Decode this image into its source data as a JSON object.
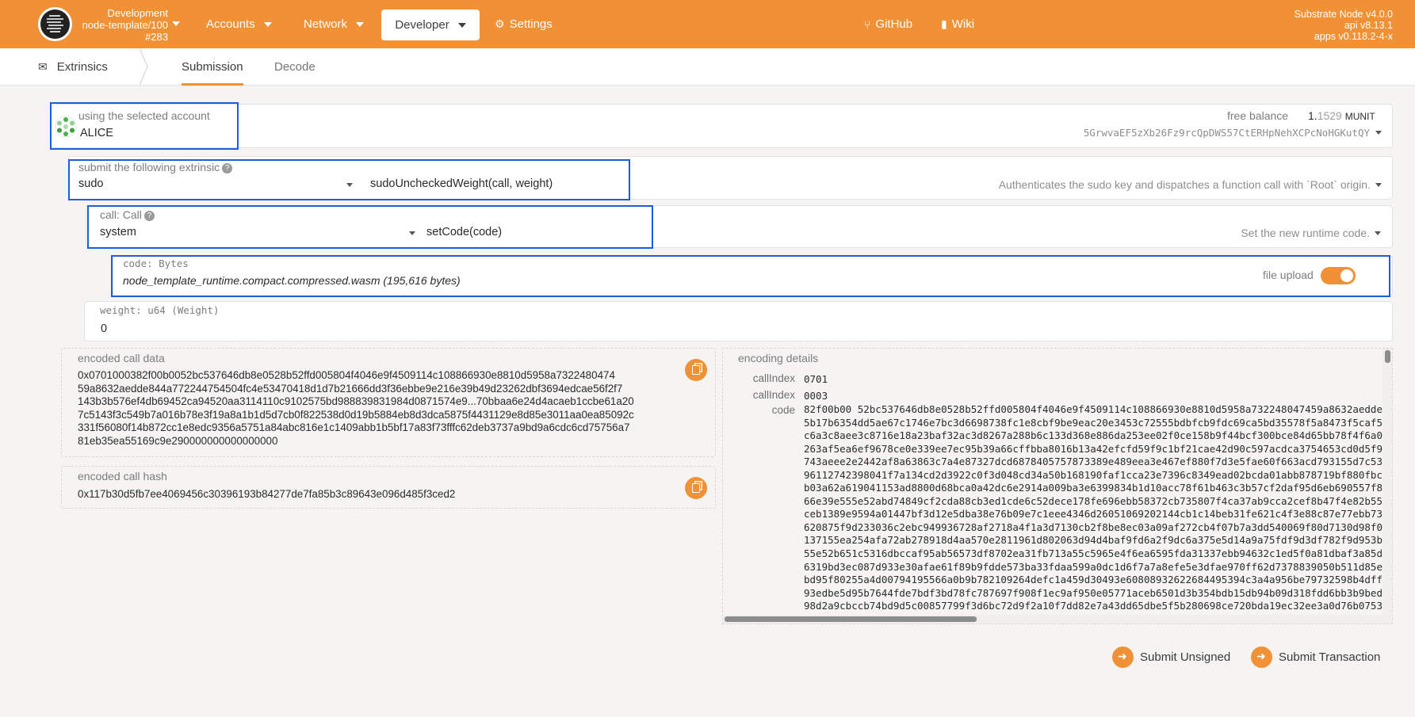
{
  "header": {
    "chain": {
      "line1": "Development",
      "line2": "node-template/100",
      "line3": "#283"
    },
    "nav": {
      "accounts": "Accounts",
      "network": "Network",
      "developer": "Developer",
      "settings": "Settings",
      "github": "GitHub",
      "wiki": "Wiki"
    },
    "node_info": {
      "line1": "Substrate Node v4.0.0",
      "line2": "api v8.13.1",
      "line3": "apps v0.118.2-4-x"
    }
  },
  "tabs": {
    "root": "Extrinsics",
    "submission": "Submission",
    "decode": "Decode"
  },
  "account": {
    "label": "using the selected account",
    "name": "ALICE",
    "balance_label": "free balance",
    "balance_int": "1.",
    "balance_frac": "1529",
    "balance_unit": "MUNIT",
    "address": "5GrwvaEF5zXb26Fz9rcQpDWS57CtERHpNehXCPcNoHGKutQY"
  },
  "extrinsic": {
    "label": "submit the following extrinsic",
    "help": "?",
    "section": "sudo",
    "method": "sudoUncheckedWeight(call, weight)",
    "description": "Authenticates the sudo key and dispatches a function call with `Root` origin."
  },
  "call": {
    "label": "call: Call",
    "help": "?",
    "section": "system",
    "method": "setCode(code)",
    "description": "Set the new runtime code."
  },
  "code_param": {
    "label": "code: Bytes",
    "file": "node_template_runtime.compact.compressed.wasm (195,616 bytes)",
    "file_upload_label": "file upload",
    "file_upload_enabled": true
  },
  "weight_param": {
    "label": "weight: u64 (Weight)",
    "value": "0"
  },
  "encoded_call_data": {
    "label": "encoded call data",
    "lines": [
      "0x0701000382f00b0052bc537646db8e0528b52ffd005804f4046e9f4509114c108866930e8810d5958a7322480474",
      "59a8632aedde844a772244754504fc4e53470418d1d7b21666dd3f36ebbe9e216e39b49d23262dbf3694edcae56f2f7",
      "143b3b576ef4db69452ca94520aa3114110c9102575bd988839831984d0871574e9...70bbaa6e24d4acaeb1ccbe61a20",
      "7c5143f3c549b7a016b78e3f19a8a1b1d5d7cb0f822538d0d19b5884eb8d3dca5875f4431129e8d85e3011aa0ea85092c",
      "331f56080f14b872cc1e8edc9356a5751a84abc816e1c1409abb1b5bf17a83f73fffc62deb3737a9bd9a6cdc6cd75756a7",
      "81eb35ea55169c9e290000000000000000"
    ]
  },
  "encoded_call_hash": {
    "label": "encoded call hash",
    "value": "0x117b30d5fb7ee4069456c30396193b84277de7fa85b3c89643e096d485f3ced2"
  },
  "encoding_details": {
    "label": "encoding details",
    "call_index_label": "callIndex",
    "call_index_1": "0701",
    "call_index_2": "0003",
    "code_label": "code",
    "code_lines": [
      "82f00b00 52bc537646db8e0528b52ffd005804f4046e9f4509114c108866930e8810d5958a732248047459a8632aedde",
      "5b17b6354dd5ae67c1746e7bc3d6698738fc1e8cbf9be9eac20e3453c72555bdbfcb9fdc69ca5bd35578f5a8473f5caf5",
      "c6a3c8aee3c8716e18a23baf32ac3d8267a288b6c133d368e886da253ee02f0ce158b9f44bcf300bce84d65bb78f4f6a0",
      "263af5ea6ef9678ce0e339ee7ec95b39a66cffbba8016b13a42efcfd59f9c1bf21cae42d90c597acdca3754653cd0d5f9",
      "743aeee2e2442af8a63863c7a4e87327dcd6878405757873389e489eea3e467ef880f7d3e5fae60f663acd793155d7c53",
      "96112742398041f7a134cd2d3922c0f3d048cd34a50b168190faf1cca23e7396c8349ead02bcda01abb878719bf880fbc",
      "b03a62a619041153ad8800d68bca0a42dc6e2914a009ba3e6399834b1d10acc78f61b463c3b57cf2daf95d6eb690557f8",
      "66e39e555e52abd74849cf2cda88cb3ed1cde6c52dece178fe696ebb58372cb735807f4ca37ab9cca2cef8b47f4e82b55",
      "ceb1389e9594a01447bf3d12e5dba38e76b09e7c1eee4346d26051069202144cb1c14beb31fe621c4f3e88c87e77ebb73",
      "620875f9d233036c2ebc949936728af2718a4f1a3d7130cb2f8be8ec03a09af272cb4f07b7a3dd540069f80d7130d98f0",
      "137155ea254afa72ab278918d4aa570e2811961d802063d94d4baf9fd6a2f9dc6a375e5d14a9a75fdf9d3df782f9d953b",
      "55e52b651c5316dbccaf95ab56573df8702ea31fb713a55c5965e4f6ea6595fda31337ebb94632c1ed5f0a81dbaf3a85d",
      "6319bd3ec087d933e30afae61f89b9fdde573ba33fdaa599a0dc1d6f7a7a8efe5e3dfae970ff62d7378839050b511d85e",
      "bd95f80255a4d00794195566a0b9b782109264defc1a459d30493e60808932622684495394c3a4a956be79732598b4dffc",
      "93edbe5d95b7644fde7bdf3bd78fc787697f908f1ec9af950e05771aceb6501d3b354bdb15db94b09d318fdd6bb3b9bed",
      "98d2a9cbccb74bd9d5c00857799f3d6bc72d9f2a10f7dd82e7a43dd65dbe5f5b280698ce720bda19ec32ee3a0d76b0753"
    ]
  },
  "actions": {
    "submit_unsigned": "Submit Unsigned",
    "submit_transaction": "Submit Transaction"
  },
  "colors": {
    "accent": "#f19135",
    "highlight": "#1a5fe0"
  }
}
